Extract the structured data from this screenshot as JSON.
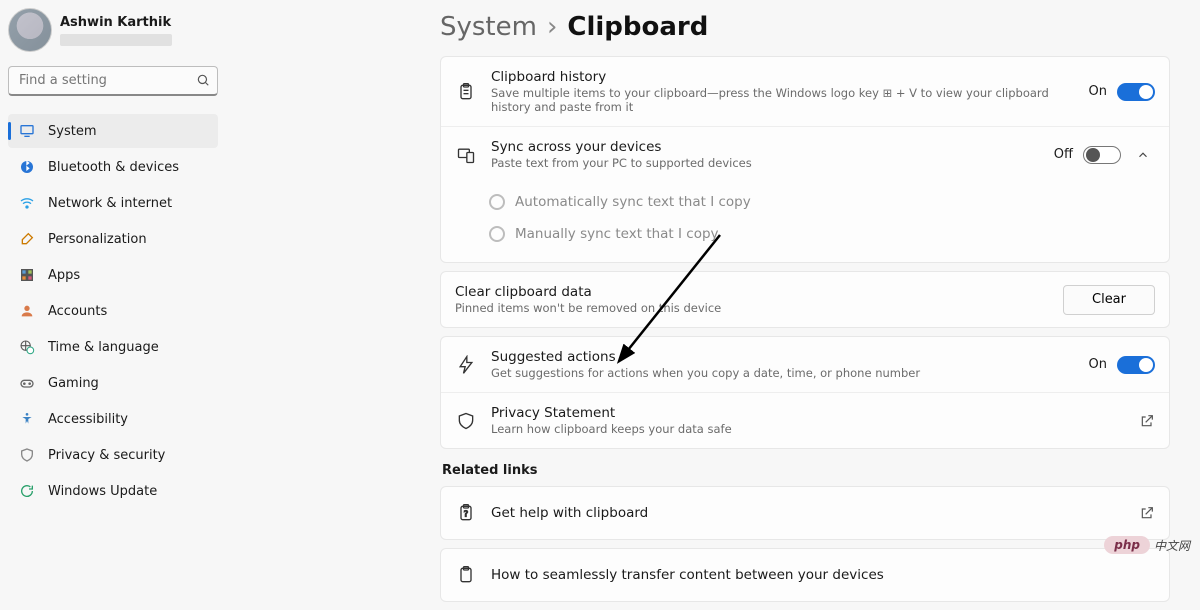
{
  "user": {
    "name": "Ashwin Karthik"
  },
  "search": {
    "placeholder": "Find a setting"
  },
  "nav": [
    {
      "label": "System",
      "selected": true
    },
    {
      "label": "Bluetooth & devices"
    },
    {
      "label": "Network & internet"
    },
    {
      "label": "Personalization"
    },
    {
      "label": "Apps"
    },
    {
      "label": "Accounts"
    },
    {
      "label": "Time & language"
    },
    {
      "label": "Gaming"
    },
    {
      "label": "Accessibility"
    },
    {
      "label": "Privacy & security"
    },
    {
      "label": "Windows Update"
    }
  ],
  "breadcrumb": {
    "root": "System",
    "current": "Clipboard"
  },
  "settings": {
    "history": {
      "title": "Clipboard history",
      "sub": "Save multiple items to your clipboard—press the Windows logo key ⊞ + V to view your clipboard history and paste from it",
      "state": "On",
      "on": true
    },
    "sync": {
      "title": "Sync across your devices",
      "sub": "Paste text from your PC to supported devices",
      "state": "Off",
      "on": false,
      "expanded": true,
      "opts": [
        "Automatically sync text that I copy",
        "Manually sync text that I copy"
      ]
    },
    "clear": {
      "title": "Clear clipboard data",
      "sub": "Pinned items won't be removed on this device",
      "button": "Clear"
    },
    "suggested": {
      "title": "Suggested actions",
      "sub": "Get suggestions for actions when you copy a date, time, or phone number",
      "state": "On",
      "on": true
    },
    "privacy": {
      "title": "Privacy Statement",
      "sub": "Learn how clipboard keeps your data safe"
    }
  },
  "related": {
    "header": "Related links",
    "help": "Get help with clipboard",
    "howto": "How to seamlessly transfer content between your devices"
  },
  "watermark": {
    "pill": "php",
    "text": "中文网"
  }
}
